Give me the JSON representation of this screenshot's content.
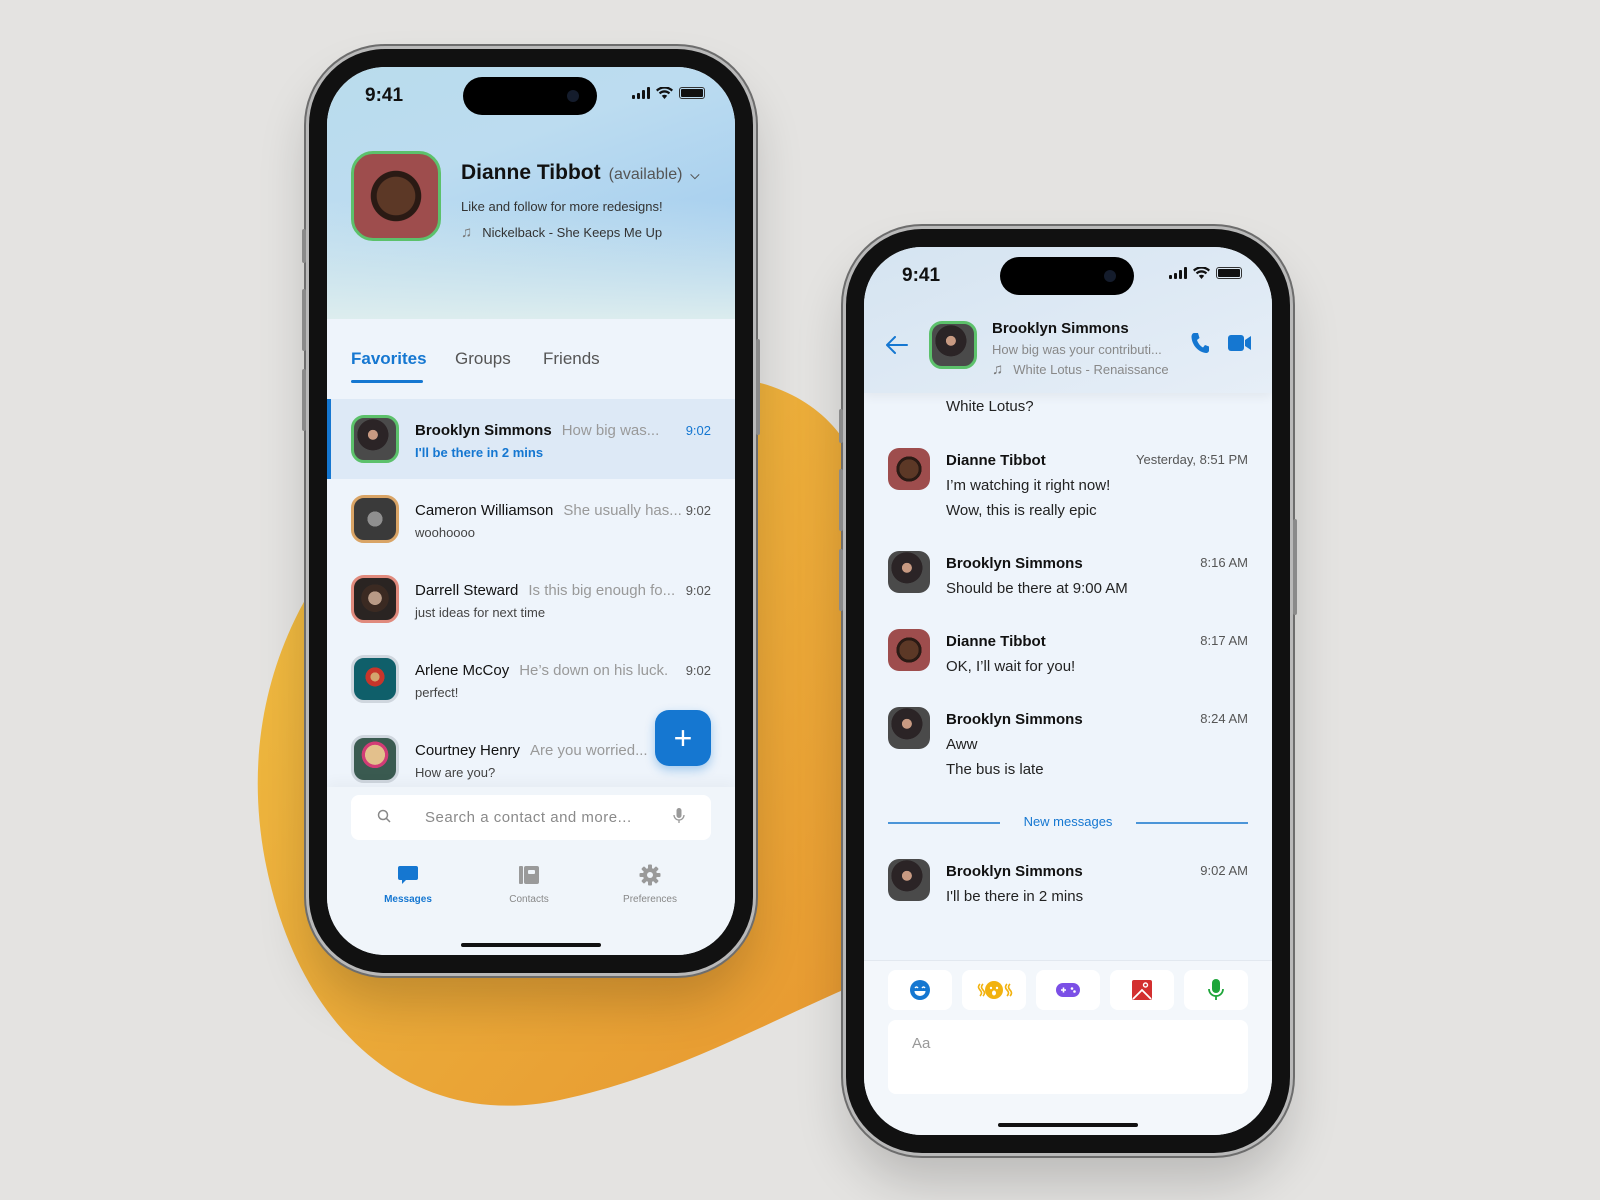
{
  "colors": {
    "accent": "#1577d1",
    "status_online": "#5cc16b",
    "backdrop_blob": "#eaa63a",
    "backdrop": "#e4e3e1"
  },
  "status_bar": {
    "time": "9:41"
  },
  "contacts_screen": {
    "profile": {
      "name": "Dianne Tibbot",
      "status": "(available)",
      "bio": "Like and follow for more redesigns!",
      "song": "Nickelback - She Keeps Me Up"
    },
    "tabs": [
      {
        "label": "Favorites",
        "active": true
      },
      {
        "label": "Groups",
        "active": false
      },
      {
        "label": "Friends",
        "active": false
      }
    ],
    "chats": [
      {
        "name": "Brooklyn Simmons",
        "preview": "How big was...",
        "time": "9:02",
        "last": "I'll be there in 2 mins",
        "ring": "#5cc16b",
        "avatar": "face-brooklyn",
        "selected": true
      },
      {
        "name": "Cameron Williamson",
        "preview": "She usually has...",
        "time": "9:02",
        "last": "woohoooo",
        "ring": "#d9a466",
        "avatar": "face-cameron",
        "selected": false
      },
      {
        "name": "Darrell Steward",
        "preview": "Is this big enough fo...",
        "time": "9:02",
        "last": "just ideas for next time",
        "ring": "#e08a7d",
        "avatar": "face-darrell",
        "selected": false
      },
      {
        "name": "Arlene McCoy",
        "preview": "He’s down on his luck.",
        "time": "9:02",
        "last": "perfect!",
        "ring": "#cfd6de",
        "avatar": "face-arlene",
        "selected": false
      },
      {
        "name": "Courtney Henry",
        "preview": "Are you worried...",
        "time": "9:02",
        "last": "How are you?",
        "ring": "#cfd6de",
        "avatar": "face-courtney",
        "selected": false
      }
    ],
    "fab_label": "+",
    "search": {
      "placeholder": "Search a contact and more..."
    },
    "nav": [
      {
        "label": "Messages",
        "icon": "chat-bubble-icon",
        "active": true
      },
      {
        "label": "Contacts",
        "icon": "contacts-book-icon",
        "active": false
      },
      {
        "label": "Preferences",
        "icon": "gear-icon",
        "active": false
      }
    ]
  },
  "conversation_screen": {
    "header": {
      "name": "Brooklyn Simmons",
      "preview": "How big was your contributi...",
      "song": "White Lotus - Renaissance"
    },
    "cut_off_text": "White Lotus?",
    "messages": [
      {
        "sender": "Dianne Tibbot",
        "time": "Yesterday, 8:51 PM",
        "lines": [
          "I’m watching it right now!",
          "Wow, this is really epic"
        ],
        "avatar": "face-dianne"
      },
      {
        "sender": "Brooklyn Simmons",
        "time": "8:16 AM",
        "lines": [
          "Should be there at 9:00 AM"
        ],
        "avatar": "face-brooklyn"
      },
      {
        "sender": "Dianne Tibbot",
        "time": "8:17 AM",
        "lines": [
          "OK, I’ll wait for you!"
        ],
        "avatar": "face-dianne"
      },
      {
        "sender": "Brooklyn Simmons",
        "time": "8:24 AM",
        "lines": [
          "Aww",
          "The bus is late"
        ],
        "avatar": "face-brooklyn"
      }
    ],
    "divider_label": "New messages",
    "new_messages": [
      {
        "sender": "Brooklyn Simmons",
        "time": "9:02 AM",
        "lines": [
          "I'll be there in 2 mins"
        ],
        "avatar": "face-brooklyn"
      }
    ],
    "quick_actions": [
      {
        "icon": "emoji-icon",
        "color": "#1577d1"
      },
      {
        "icon": "nudge-icon",
        "color": "#f2b20f"
      },
      {
        "icon": "game-controller-icon",
        "color": "#7b4fe6"
      },
      {
        "icon": "image-icon",
        "color": "#d32f2f"
      },
      {
        "icon": "microphone-icon",
        "color": "#1ea53a"
      }
    ],
    "composer_placeholder": "Aa"
  }
}
